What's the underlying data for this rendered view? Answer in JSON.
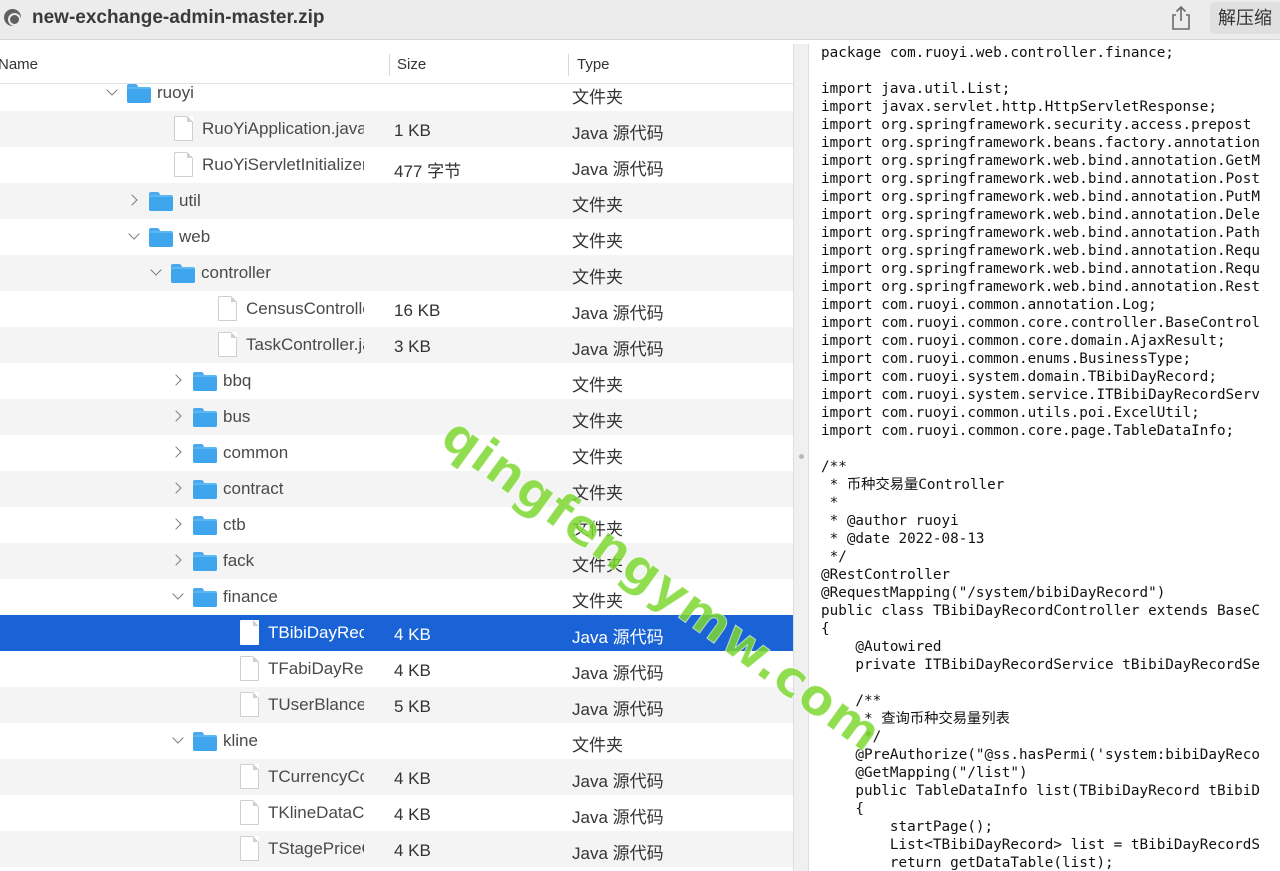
{
  "titlebar": {
    "title": "new-exchange-admin-master.zip",
    "unzip_label": "解压缩",
    "icons": {
      "app": "zip-archive-icon",
      "share": "share-icon"
    }
  },
  "browser": {
    "columns": {
      "name": "Name",
      "size": "Size",
      "type": "Type"
    },
    "rows": [
      {
        "name": "ruoyi",
        "size": "",
        "type": "文件夹",
        "kind": "folder",
        "expanded": true,
        "depth": 0
      },
      {
        "name": "RuoYiApplication.java",
        "size": "1 KB",
        "type": "Java 源代码",
        "kind": "file",
        "depth": 1
      },
      {
        "name": "RuoYiServletInitializer.",
        "size": "477 字节",
        "type": "Java 源代码",
        "kind": "file",
        "depth": 1
      },
      {
        "name": "util",
        "size": "",
        "type": "文件夹",
        "kind": "folder",
        "expanded": false,
        "depth": 1
      },
      {
        "name": "web",
        "size": "",
        "type": "文件夹",
        "kind": "folder",
        "expanded": true,
        "depth": 1
      },
      {
        "name": "controller",
        "size": "",
        "type": "文件夹",
        "kind": "folder",
        "expanded": true,
        "depth": 2
      },
      {
        "name": "CensusControlle",
        "size": "16 KB",
        "type": "Java 源代码",
        "kind": "file",
        "depth": 3
      },
      {
        "name": "TaskController.ja",
        "size": "3 KB",
        "type": "Java 源代码",
        "kind": "file",
        "depth": 3
      },
      {
        "name": "bbq",
        "size": "",
        "type": "文件夹",
        "kind": "folder",
        "expanded": false,
        "depth": 3
      },
      {
        "name": "bus",
        "size": "",
        "type": "文件夹",
        "kind": "folder",
        "expanded": false,
        "depth": 3
      },
      {
        "name": "common",
        "size": "",
        "type": "文件夹",
        "kind": "folder",
        "expanded": false,
        "depth": 3
      },
      {
        "name": "contract",
        "size": "",
        "type": "文件夹",
        "kind": "folder",
        "expanded": false,
        "depth": 3
      },
      {
        "name": "ctb",
        "size": "",
        "type": "文件夹",
        "kind": "folder",
        "expanded": false,
        "depth": 3
      },
      {
        "name": "fack",
        "size": "",
        "type": "文件夹",
        "kind": "folder",
        "expanded": false,
        "depth": 3
      },
      {
        "name": "finance",
        "size": "",
        "type": "文件夹",
        "kind": "folder",
        "expanded": true,
        "depth": 3
      },
      {
        "name": "TBibiDayReco",
        "size": "4 KB",
        "type": "Java 源代码",
        "kind": "file",
        "depth": 4,
        "selected": true
      },
      {
        "name": "TFabiDayRecc",
        "size": "4 KB",
        "type": "Java 源代码",
        "kind": "file",
        "depth": 4
      },
      {
        "name": "TUserBlanceC",
        "size": "5 KB",
        "type": "Java 源代码",
        "kind": "file",
        "depth": 4
      },
      {
        "name": "kline",
        "size": "",
        "type": "文件夹",
        "kind": "folder",
        "expanded": true,
        "depth": 3
      },
      {
        "name": "TCurrencyCor",
        "size": "4 KB",
        "type": "Java 源代码",
        "kind": "file",
        "depth": 4
      },
      {
        "name": "TKlineDataCo",
        "size": "4 KB",
        "type": "Java 源代码",
        "kind": "file",
        "depth": 4
      },
      {
        "name": "TStagePriceC",
        "size": "4 KB",
        "type": "Java 源代码",
        "kind": "file",
        "depth": 4
      }
    ]
  },
  "code": {
    "lines": [
      "package com.ruoyi.web.controller.finance;",
      "",
      "import java.util.List;",
      "import javax.servlet.http.HttpServletResponse;",
      "import org.springframework.security.access.prepost",
      "import org.springframework.beans.factory.annotation",
      "import org.springframework.web.bind.annotation.GetM",
      "import org.springframework.web.bind.annotation.Post",
      "import org.springframework.web.bind.annotation.PutM",
      "import org.springframework.web.bind.annotation.Dele",
      "import org.springframework.web.bind.annotation.Path",
      "import org.springframework.web.bind.annotation.Requ",
      "import org.springframework.web.bind.annotation.Requ",
      "import org.springframework.web.bind.annotation.Rest",
      "import com.ruoyi.common.annotation.Log;",
      "import com.ruoyi.common.core.controller.BaseControl",
      "import com.ruoyi.common.core.domain.AjaxResult;",
      "import com.ruoyi.common.enums.BusinessType;",
      "import com.ruoyi.system.domain.TBibiDayRecord;",
      "import com.ruoyi.system.service.ITBibiDayRecordServ",
      "import com.ruoyi.common.utils.poi.ExcelUtil;",
      "import com.ruoyi.common.core.page.TableDataInfo;",
      "",
      "/**",
      " * 币种交易量Controller",
      " *",
      " * @author ruoyi",
      " * @date 2022-08-13",
      " */",
      "@RestController",
      "@RequestMapping(\"/system/bibiDayRecord\")",
      "public class TBibiDayRecordController extends BaseC",
      "{",
      "    @Autowired",
      "    private ITBibiDayRecordService tBibiDayRecordSe",
      "",
      "    /**",
      "     * 查询币种交易量列表",
      "     */",
      "    @PreAuthorize(\"@ss.hasPermi('system:bibiDayReco",
      "    @GetMapping(\"/list\")",
      "    public TableDataInfo list(TBibiDayRecord tBibiD",
      "    {",
      "        startPage();",
      "        List<TBibiDayRecord> list = tBibiDayRecordS",
      "        return getDataTable(list);"
    ]
  },
  "watermark": {
    "text": "qingfengymw.com"
  },
  "colors": {
    "selection": "#1a63d6",
    "folder": "#3fa5ec",
    "watermark": "#7cd730"
  }
}
